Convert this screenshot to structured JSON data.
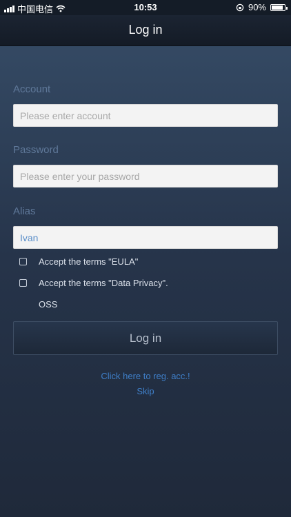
{
  "status_bar": {
    "carrier": "中国电信",
    "time": "10:53",
    "battery": "90%",
    "battery_level": 0.9
  },
  "nav": {
    "title": "Log in"
  },
  "form": {
    "account_label": "Account",
    "account_placeholder": "Please enter account",
    "account_value": "",
    "password_label": "Password",
    "password_placeholder": "Please enter your password",
    "password_value": "",
    "alias_label": "Alias",
    "alias_placeholder": "",
    "alias_value": "Ivan",
    "eula_label": "Accept the terms \"EULA\"",
    "eula_checked": false,
    "privacy_label": "Accept the terms \"Data Privacy\".",
    "privacy_checked": false,
    "oss_label": "OSS",
    "login_button": "Log in"
  },
  "links": {
    "register": "Click here to reg. acc.!",
    "skip": "Skip"
  },
  "colors": {
    "accent": "#3f7fc9",
    "background": "#1f2a3b"
  }
}
